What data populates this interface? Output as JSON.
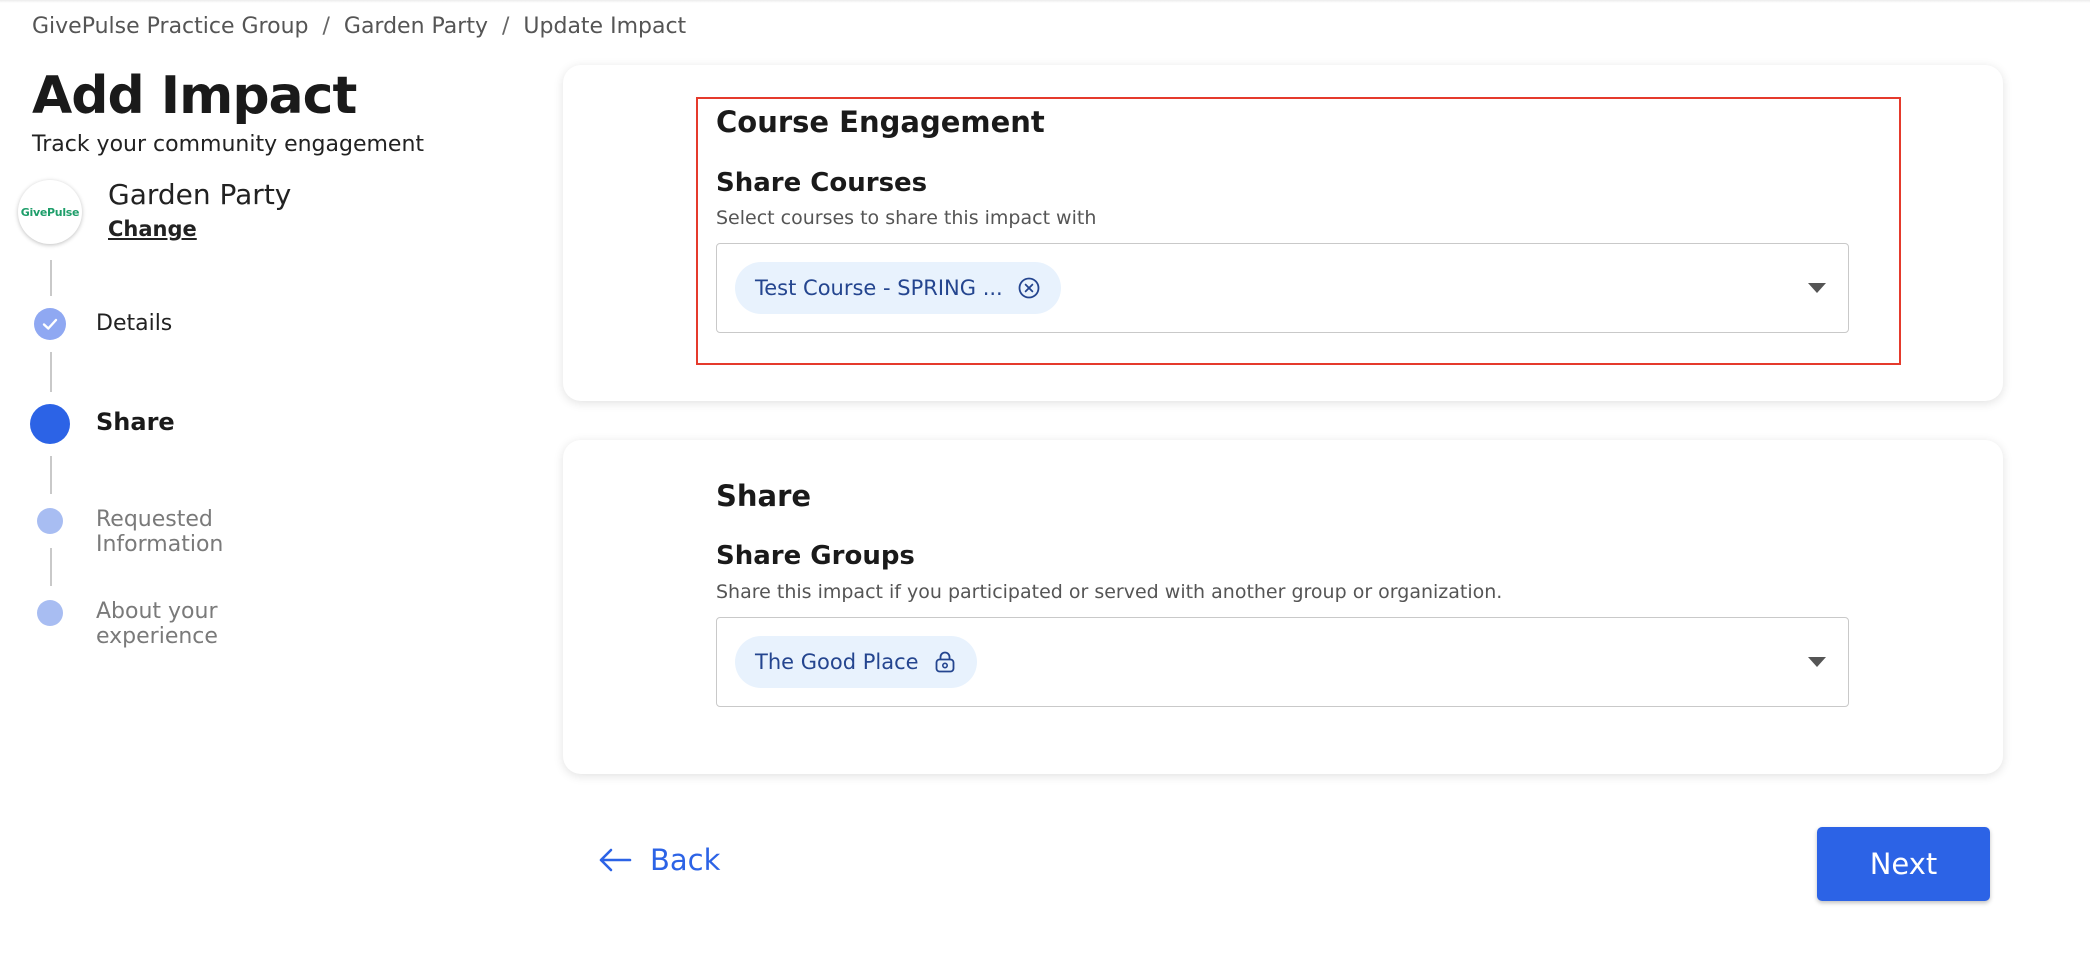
{
  "breadcrumb": {
    "items": [
      "GivePulse Practice Group",
      "Garden Party",
      "Update Impact"
    ],
    "separator": "/"
  },
  "header": {
    "title": "Add Impact",
    "subtitle": "Track your community engagement"
  },
  "organization": {
    "logo_text": "GivePulse",
    "name": "Garden Party",
    "change_label": "Change"
  },
  "steps": [
    {
      "label": "Details",
      "state": "done"
    },
    {
      "label": "Share",
      "state": "active"
    },
    {
      "label": "Requested Information",
      "state": "pending"
    },
    {
      "label": "About your experience",
      "state": "pending"
    }
  ],
  "course_section": {
    "title": "Course Engagement",
    "field_title": "Share Courses",
    "help": "Select courses to share this impact with",
    "selected_chip": "Test Course - SPRING ...",
    "chip_icon": "close-circle-icon"
  },
  "share_section": {
    "title": "Share",
    "field_title": "Share Groups",
    "help": "Share this impact if you participated or served with another group or organization.",
    "selected_chip": "The Good Place",
    "chip_icon": "lock-icon"
  },
  "footer": {
    "back_label": "Back",
    "next_label": "Next"
  },
  "colors": {
    "primary": "#2c63e6",
    "highlight": "#e53a2c",
    "chip_bg": "#e8f2fd",
    "step_done": "#8fa8f2",
    "step_pending": "#a8bdf2"
  }
}
